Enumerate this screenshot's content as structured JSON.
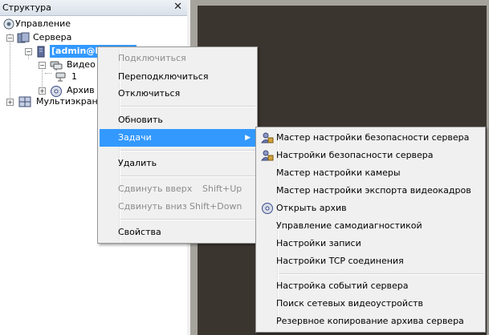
{
  "panel": {
    "title": "Структура",
    "close_glyph": "✕"
  },
  "tree": {
    "root": "Управление",
    "servers": "Сервера",
    "server_node": "[admin@localhost]",
    "video": "Видео",
    "camera": "1",
    "archive": "Архив",
    "multiscreens": "Мультиэкраны"
  },
  "context_menu": {
    "items": [
      {
        "label": "Подключиться",
        "disabled": true
      },
      {
        "label": "Переподключиться"
      },
      {
        "label": "Отключиться"
      },
      {
        "label": "Обновить"
      },
      {
        "label": "Задачи",
        "highlighted": true,
        "submenu_arrow": "▶"
      },
      {
        "label": "Удалить"
      },
      {
        "label": "Сдвинуть вверх",
        "shortcut": "Shift+Up",
        "disabled": true
      },
      {
        "label": "Сдвинуть вниз",
        "shortcut": "Shift+Down",
        "disabled": true
      },
      {
        "label": "Свойства"
      }
    ]
  },
  "submenu": {
    "items": [
      {
        "label": "Мастер настройки безопасности сервера",
        "icon": "security-users-icon"
      },
      {
        "label": "Настройки безопасности сервера",
        "icon": "security-users-icon"
      },
      {
        "label": "Мастер настройки камеры"
      },
      {
        "label": "Мастер настройки экспорта видеокадров"
      },
      {
        "label": "Открыть архив",
        "icon": "archive-disc-icon"
      },
      {
        "label": "Управление самодиагностикой"
      },
      {
        "label": "Настройки записи"
      },
      {
        "label": "Настройки TCP соединения"
      },
      {
        "label": "Настройка событий сервера"
      },
      {
        "label": "Поиск сетевых видеоустройств"
      },
      {
        "label": "Резервное копирование архива сервера"
      }
    ]
  },
  "colors": {
    "selection": "#3399ff",
    "video_bg": "#3b3530",
    "menu_bg": "#f0f0f0"
  }
}
